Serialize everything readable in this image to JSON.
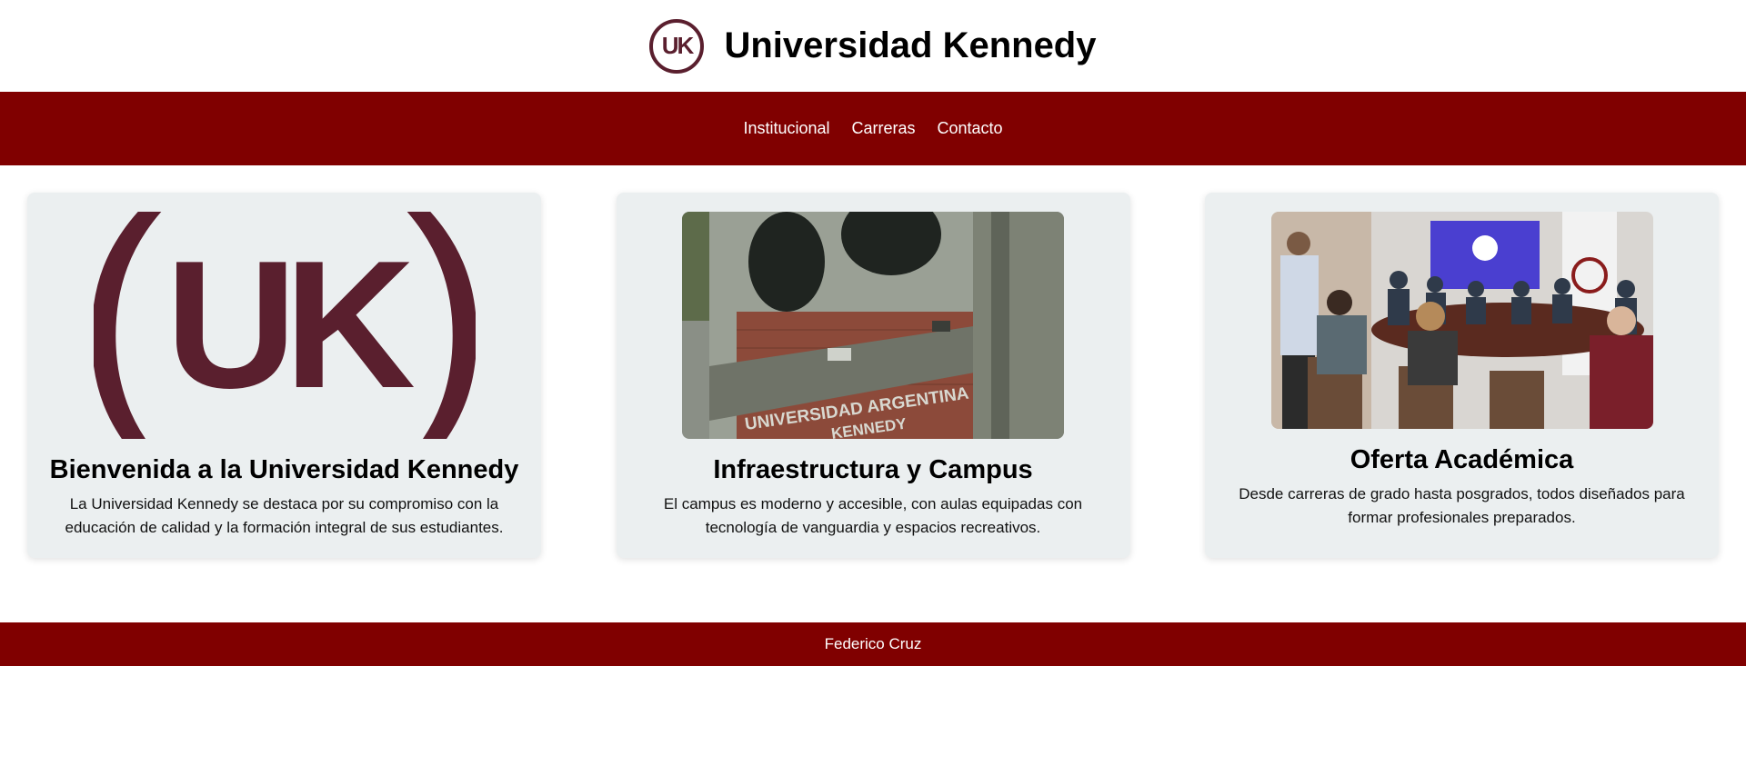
{
  "header": {
    "logo_text": "UK",
    "title": "Universidad Kennedy"
  },
  "nav": {
    "items": [
      {
        "label": "Institucional"
      },
      {
        "label": "Carreras"
      },
      {
        "label": "Contacto"
      }
    ]
  },
  "cards": [
    {
      "image": "uk-logo-large",
      "logo_text": "UK",
      "title": "Bienvenida a la Universidad Kennedy",
      "text": "La Universidad Kennedy se destaca por su compromiso con la educación de calidad y la formación integral de sus estudiantes."
    },
    {
      "image": "campus-building-photo",
      "sign_line1": "UNIVERSIDAD ARGENTINA",
      "sign_line2": "KENNEDY",
      "title": "Infraestructura y Campus",
      "text": "El campus es moderno y accesible, con aulas equipadas con tecnología de vanguardia y espacios recreativos."
    },
    {
      "image": "meeting-room-photo",
      "title": "Oferta Académica",
      "text": "Desde carreras de grado hasta posgrados, todos diseñados para formar profesionales preparados."
    }
  ],
  "footer": {
    "text": "Federico Cruz"
  },
  "colors": {
    "brand": "#800000",
    "logo": "#5a1f2e",
    "card_bg": "#ebeff0"
  }
}
